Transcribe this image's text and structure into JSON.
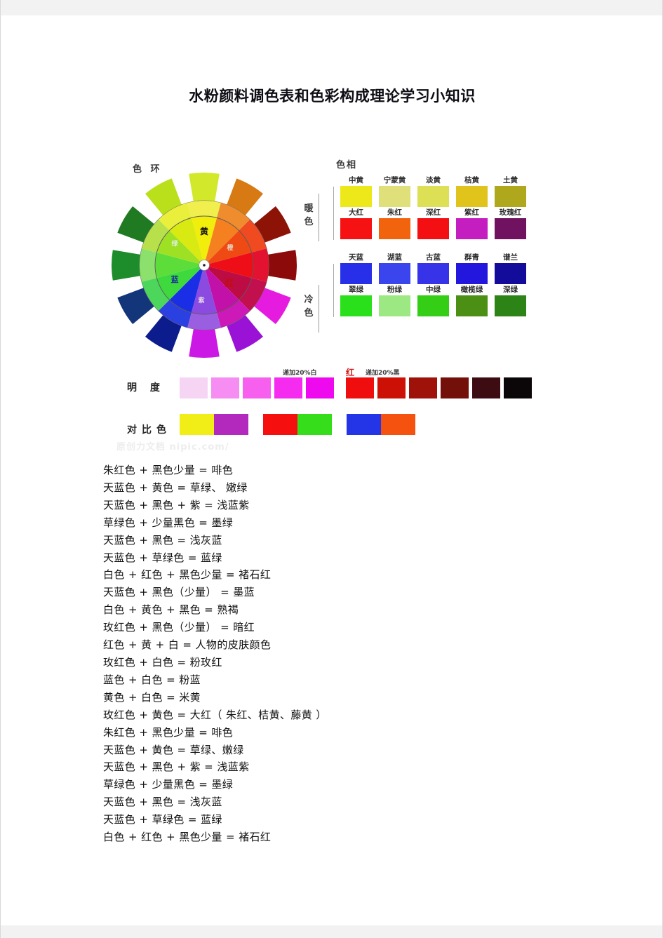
{
  "document": {
    "title": "水粉颜料调色表和色彩构成理论学习小知识",
    "watermark": "原创力文档 nipic.com/"
  },
  "figure": {
    "wheel_label": "色 环",
    "warm_label": "暖色",
    "cool_label": "冷色",
    "wheel_inner_labels": {
      "yellow": "黄",
      "orange": "橙",
      "red": "红",
      "purple": "紫",
      "blue": "蓝",
      "green": "绿"
    },
    "hue_title": "色相",
    "hue_rows": [
      {
        "group": "warm-yellow",
        "swatches": [
          {
            "name": "中黄",
            "color": "#ede81a"
          },
          {
            "name": "宁蒙黄",
            "color": "#dfe07a"
          },
          {
            "name": "淡黄",
            "color": "#dde055"
          },
          {
            "name": "桔黄",
            "color": "#e0c41c"
          },
          {
            "name": "土黄",
            "color": "#b0a81c"
          }
        ]
      },
      {
        "group": "warm-red",
        "swatches": [
          {
            "name": "大红",
            "color": "#f61212"
          },
          {
            "name": "朱红",
            "color": "#f2630d"
          },
          {
            "name": "深红",
            "color": "#f40f12"
          },
          {
            "name": "紫红",
            "color": "#c51ec0"
          },
          {
            "name": "玫瑰红",
            "color": "#70125f"
          }
        ]
      },
      {
        "group": "cool-blue",
        "swatches": [
          {
            "name": "天蓝",
            "color": "#2730e8"
          },
          {
            "name": "湖蓝",
            "color": "#3a45ee"
          },
          {
            "name": "古蓝",
            "color": "#3733e8"
          },
          {
            "name": "群青",
            "color": "#2317de"
          },
          {
            "name": "谱兰",
            "color": "#130c9a"
          }
        ]
      },
      {
        "group": "cool-green",
        "swatches": [
          {
            "name": "翠绿",
            "color": "#2ae01a"
          },
          {
            "name": "粉绿",
            "color": "#9ce882"
          },
          {
            "name": "中绿",
            "color": "#34ce16"
          },
          {
            "name": "橄榄绿",
            "color": "#4b9015"
          },
          {
            "name": "深绿",
            "color": "#2c8416"
          }
        ]
      }
    ],
    "brightness": {
      "label": "明 度",
      "annotation_white": "递加20%白",
      "annotation_center": "红",
      "annotation_black": "递加20%黑",
      "light_ramp": [
        "#f6d5f4",
        "#f58df2",
        "#f760ef",
        "#f52cf0",
        "#ef09ee"
      ],
      "dark_ramp": [
        "#f00d0d",
        "#cc1006",
        "#9e1209",
        "#731009",
        "#3d0b12",
        "#0b0608"
      ]
    },
    "contrast": {
      "label": "对比色",
      "pairs": [
        {
          "a": "#f0ee16",
          "b": "#b328bd"
        },
        {
          "a": "#f50f0f",
          "b": "#35dd1a"
        },
        {
          "a": "#2435e8",
          "b": "#f5520f"
        }
      ]
    }
  },
  "recipes": [
    "朱红色 +  黑色少量 =  啡色",
    "天蓝色 +  黄色 =  草绿、 嫩绿",
    "天蓝色 +  黑色 +  紫 =  浅蓝紫",
    "草绿色 +  少量黑色 =  墨绿",
    "天蓝色 +  黑色 =  浅灰蓝",
    "天蓝色 +  草绿色 =  蓝绿",
    "白色 +  红色 +  黑色少量 =  褚石红",
    "天蓝色 +  黑色（少量） =  墨蓝",
    "白色 +  黄色 +  黑色 =  熟褐",
    "玫红色 +  黑色（少量） =  暗红",
    "红色 +  黄 +  白 =  人物的皮肤颜色",
    "玫红色 +  白色 =  粉玫红",
    "蓝色 +  白色 =  粉蓝",
    "黄色 +  白色 =  米黄",
    "玫红色 +  黄色 =  大红（ 朱红、桔黄、藤黄 ）",
    "朱红色 +  黑色少量 =  啡色",
    "天蓝色 +  黄色 =  草绿、嫩绿",
    "天蓝色 +  黑色 +  紫 =  浅蓝紫",
    "草绿色 +  少量黑色 =  墨绿",
    "天蓝色 +  黑色 =  浅灰蓝",
    "天蓝色 +  草绿色 =  蓝绿",
    "白色 +  红色 +  黑色少量 =  褚石红"
  ],
  "wheel_data": {
    "outer_sectors": [
      "#d2e82a",
      "#d87a14",
      "#8d1307",
      "#8d0a0a",
      "#e51ce0",
      "#9a12d6",
      "#cc18e5",
      "#0c1c8c",
      "#13357a",
      "#1d8c2b",
      "#1f7a22",
      "#b9e01a"
    ],
    "mid_ring": [
      "#f0ef4d",
      "#ef8c2d",
      "#ef4a20",
      "#e31230",
      "#c2104f",
      "#cc19b8",
      "#9a5fe0",
      "#2b40e0",
      "#4dd65c",
      "#8ce06c",
      "#b7e04a",
      "#eaef3c"
    ],
    "inner_ring": [
      "#f2ee0c",
      "#f58020",
      "#f04a14",
      "#ed0e17",
      "#bd0b43",
      "#c211a8",
      "#8b4ae0",
      "#1a2fe5",
      "#3dd93d",
      "#5cdd3a",
      "#9ee024",
      "#d8ea12"
    ]
  }
}
